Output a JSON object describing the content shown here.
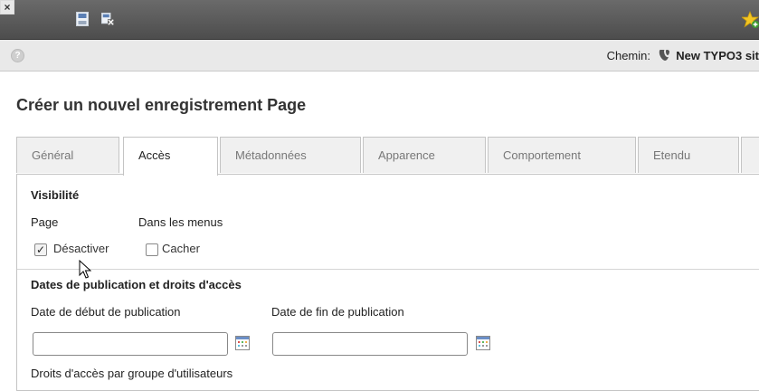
{
  "toolbar": {
    "close_icon": "close-icon",
    "save_icon": "save-icon",
    "save_close_icon": "save-and-close-icon",
    "shortcut_icon": "star-add-icon"
  },
  "pathbar": {
    "help_icon": "help-icon",
    "path_label": "Chemin:",
    "site_name": "New TYPO3 sit"
  },
  "page": {
    "title": "Créer un nouvel enregistrement Page"
  },
  "tabs": [
    {
      "label": "Général",
      "active": false
    },
    {
      "label": "Accès",
      "active": true
    },
    {
      "label": "Métadonnées",
      "active": false
    },
    {
      "label": "Apparence",
      "active": false
    },
    {
      "label": "Comportement",
      "active": false
    },
    {
      "label": "Etendu",
      "active": false
    }
  ],
  "visibility": {
    "heading": "Visibilité",
    "page_label": "Page",
    "menus_label": "Dans les menus",
    "disable_label": "Désactiver",
    "disable_checked": true,
    "hide_label": "Cacher",
    "hide_checked": false
  },
  "publication": {
    "heading": "Dates de publication et droits d'accès",
    "start_label": "Date de début de publication",
    "end_label": "Date de fin de publication",
    "start_value": "",
    "end_value": "",
    "groups_label": "Droits d'accès par groupe d'utilisateurs"
  },
  "colors": {
    "toolbar_bg": "#555555",
    "pathbar_bg": "#e9e9e9",
    "tab_inactive_bg": "#f0f0f0",
    "border": "#c4c4c4"
  }
}
